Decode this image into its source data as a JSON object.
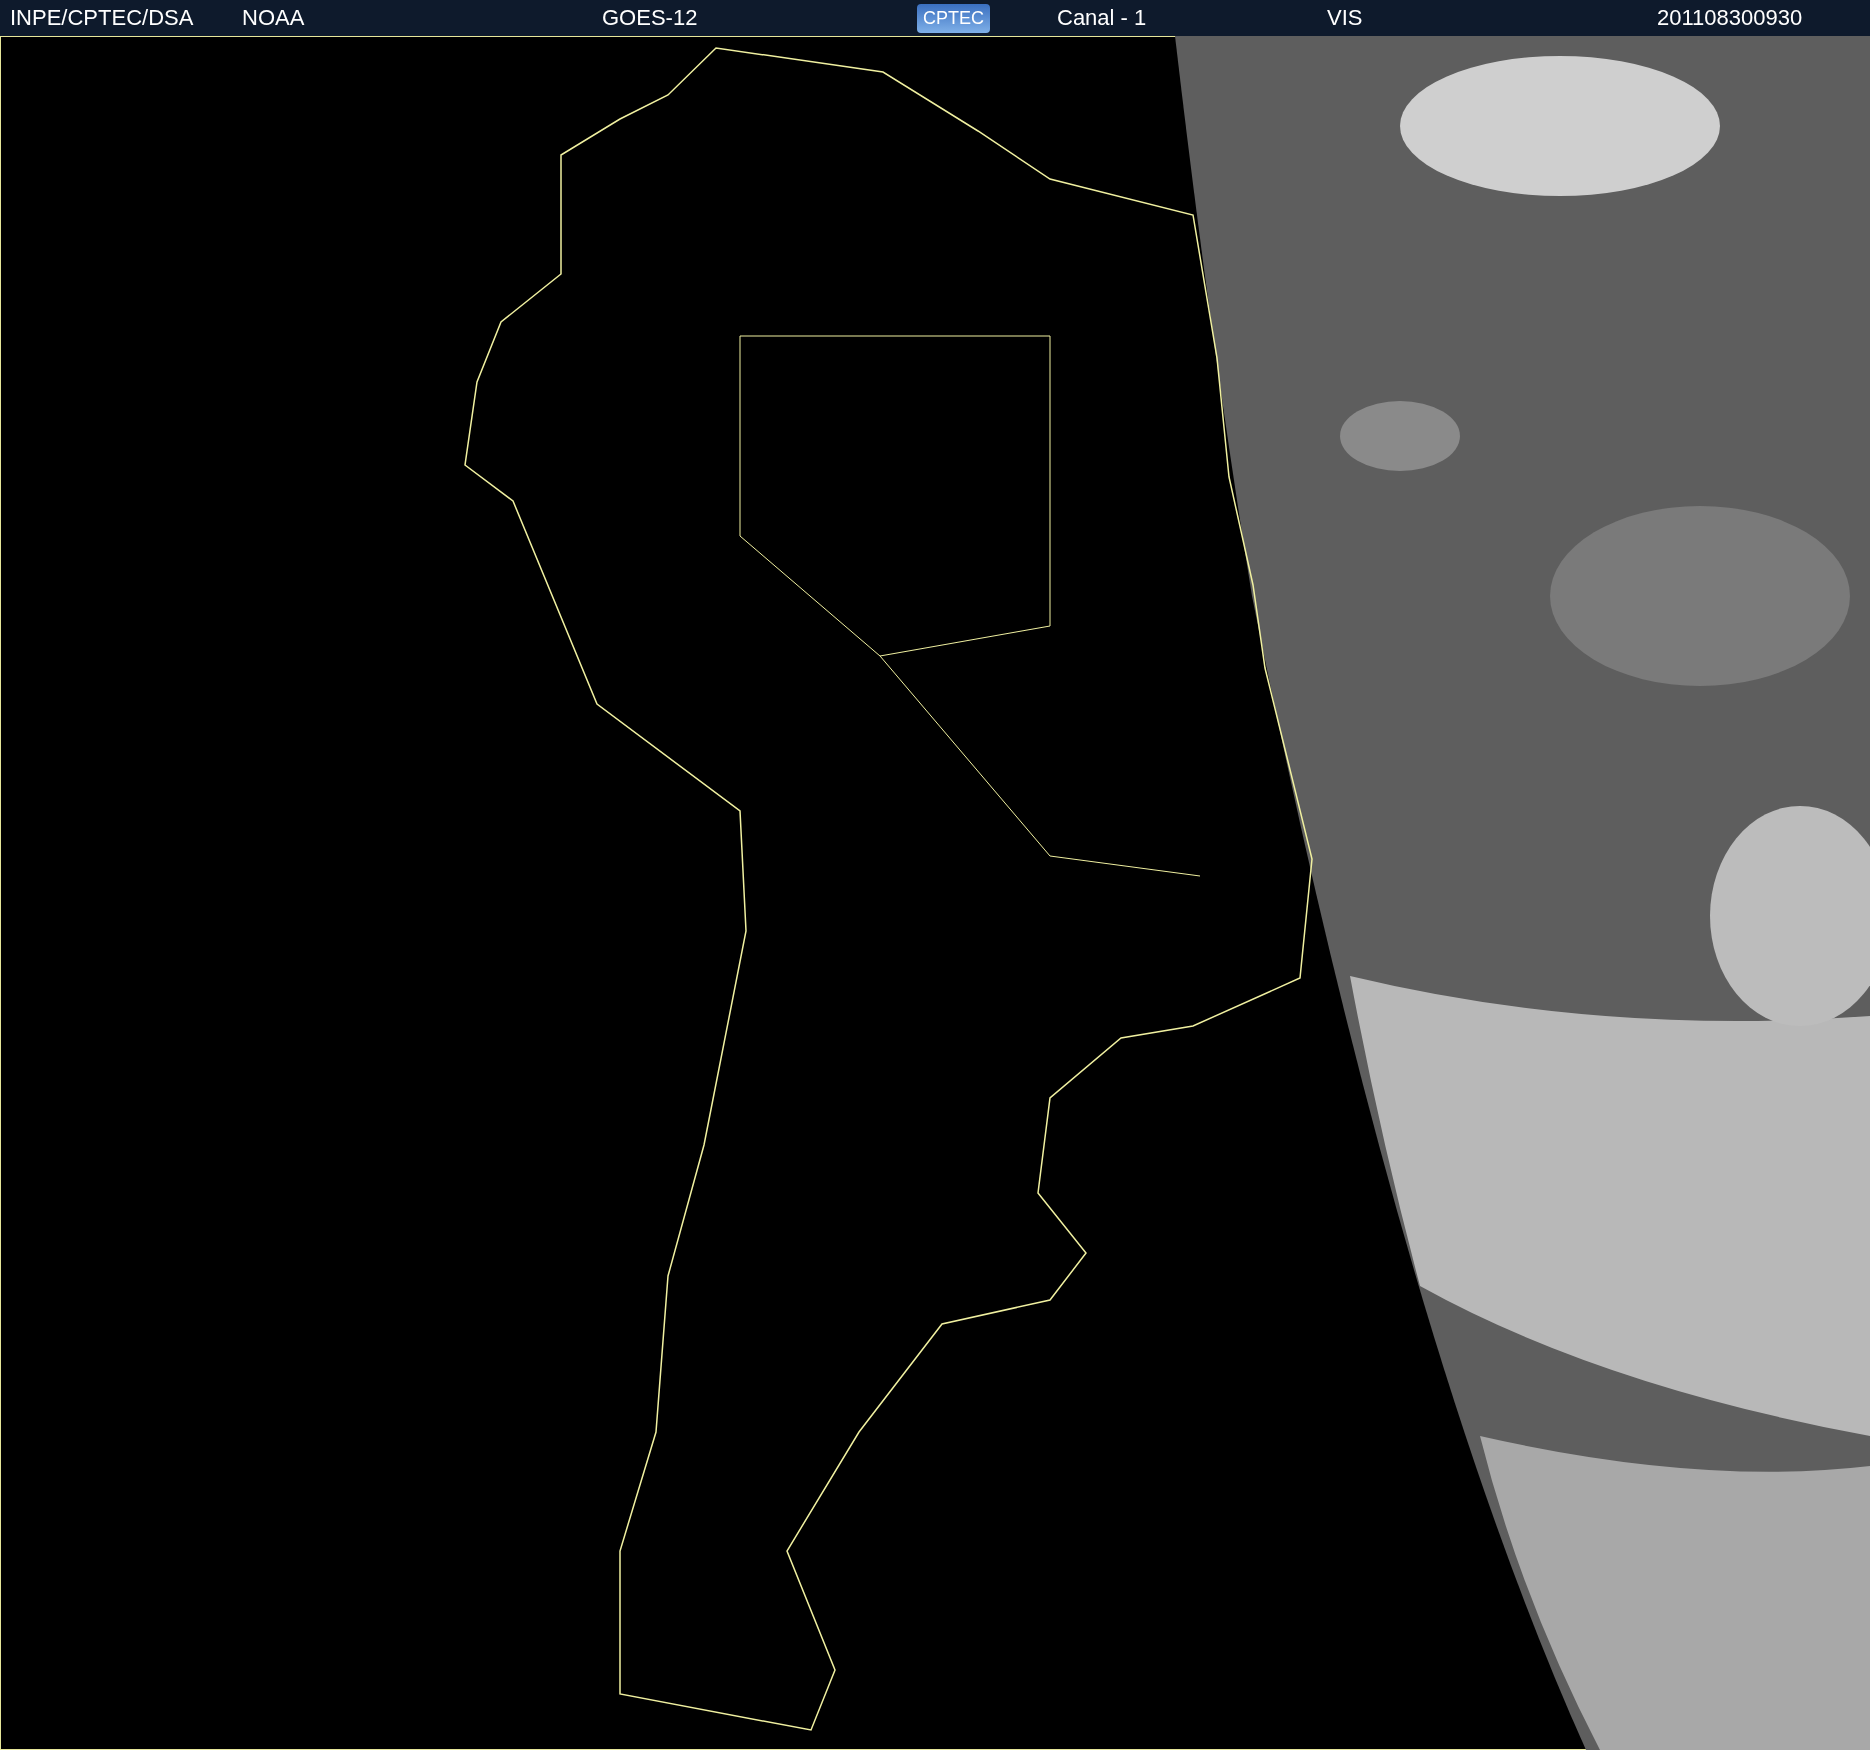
{
  "header": {
    "items": [
      {
        "kind": "text",
        "text": "INPE/CPTEC/DSA"
      },
      {
        "kind": "text",
        "text": "NOAA"
      },
      {
        "kind": "text",
        "text": "GOES-12"
      },
      {
        "kind": "logo",
        "text": "CPTEC"
      },
      {
        "kind": "text",
        "text": "Canal - 1"
      },
      {
        "kind": "text",
        "text": "VIS"
      },
      {
        "kind": "text",
        "text": "201108300930"
      }
    ]
  }
}
